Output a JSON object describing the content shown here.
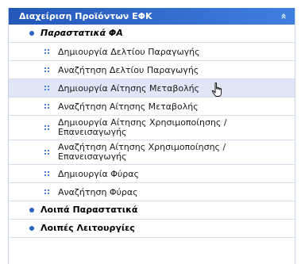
{
  "panel": {
    "title": "Διαχείριση Προϊόντων ΕΦΚ",
    "collapse_glyph": "«",
    "sections": [
      {
        "label": "Παραστατικά ΦΑ",
        "items": [
          {
            "label": "Δημιουργία Δελτίου Παραγωγής"
          },
          {
            "label": "Αναζήτηση Δελτίου Παραγωγής"
          },
          {
            "label": "Δημιουργία Αίτησης Μεταβολής"
          },
          {
            "label": "Αναζήτηση Αίτησης Μεταβολής"
          },
          {
            "label": "Δημιουργία Αίτησης Χρησιμοποίησης / Επανεισαγωγής"
          },
          {
            "label": "Αναζήτηση Αίτησης Χρησιμοποίησης / Επανεισαγωγής"
          },
          {
            "label": "Δημιουργία Φύρας"
          },
          {
            "label": "Αναζήτηση Φύρας"
          }
        ]
      },
      {
        "label": "Λοιπά Παραστατικά"
      },
      {
        "label": "Λοιπές Λειτουργίες"
      }
    ]
  },
  "colors": {
    "header_start": "#2557b8",
    "header_end": "#3f7fe0",
    "bullet": "#2a62c8",
    "hover_row": "#dfe7f6"
  },
  "icons": {
    "header_collapse": "double-chevron-up-icon",
    "category_bullet": "dot-bullet-icon",
    "item_bullet": "four-dots-icon",
    "pointer": "hand-pointer-cursor-icon"
  }
}
